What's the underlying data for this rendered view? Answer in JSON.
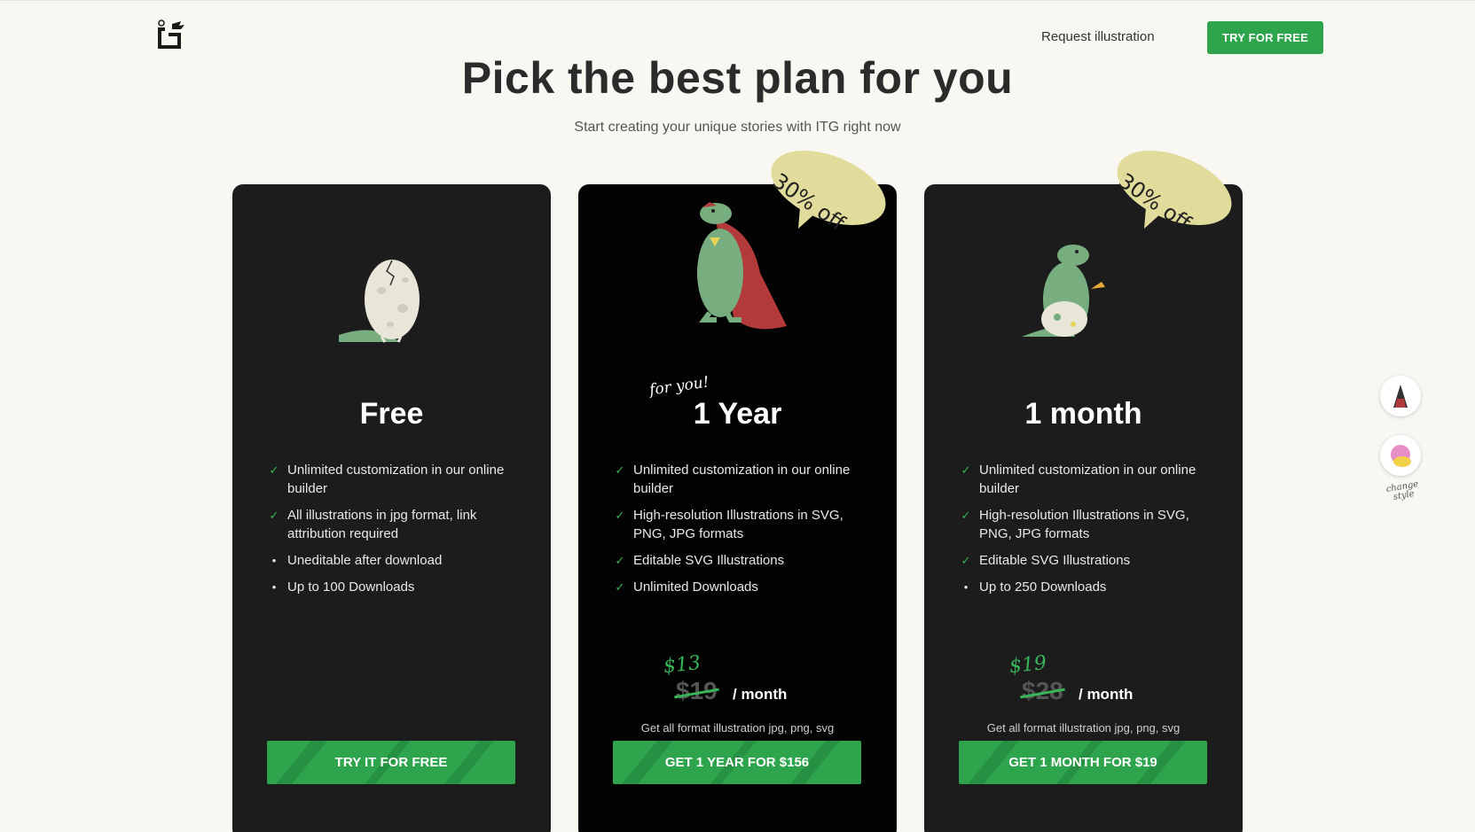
{
  "header": {
    "logo": "itg-logo",
    "nav_link": "Request illustration",
    "cta": "TRY FOR FREE"
  },
  "hero": {
    "title": "Pick the best plan for you",
    "subtitle": "Start creating your unique stories with ITG right now"
  },
  "plans": [
    {
      "name": "Free",
      "illustration": "egg-dino-icon",
      "features": [
        {
          "icon": "check",
          "text": "Unlimited customization in our online builder"
        },
        {
          "icon": "check",
          "text": "All illustrations in jpg format, link attribution required"
        },
        {
          "icon": "dot",
          "text": "Uneditable after download"
        },
        {
          "icon": "dot",
          "text": "Up to 100 Downloads"
        }
      ],
      "button": "TRY IT FOR FREE"
    },
    {
      "name": "1 Year",
      "tag": "for you!",
      "badge": "30% off",
      "illustration": "superhero-dino-icon",
      "features": [
        {
          "icon": "check",
          "text": "Unlimited customization in our online builder"
        },
        {
          "icon": "check",
          "text": "High-resolution Illustrations in SVG, PNG, JPG formats"
        },
        {
          "icon": "check",
          "text": "Editable SVG Illustrations"
        },
        {
          "icon": "check",
          "text": "Unlimited Downloads"
        }
      ],
      "new_price": "$13",
      "old_price": "$19",
      "per": "/ month",
      "note": "Get all format illustration jpg, png, svg",
      "button": "GET 1 YEAR FOR $156"
    },
    {
      "name": "1 month",
      "badge": "30% off",
      "illustration": "baby-dino-icon",
      "features": [
        {
          "icon": "check",
          "text": "Unlimited customization in our online builder"
        },
        {
          "icon": "check",
          "text": "High-resolution Illustrations in SVG, PNG, JPG formats"
        },
        {
          "icon": "check",
          "text": "Editable SVG Illustrations"
        },
        {
          "icon": "dot",
          "text": "Up to 250 Downloads"
        }
      ],
      "new_price": "$19",
      "old_price": "$28",
      "per": "/ month",
      "note": "Get all format illustration jpg, png, svg",
      "button": "GET 1 MONTH FOR $19"
    }
  ],
  "side": {
    "style_label_1": "change",
    "style_label_2": "style"
  },
  "colors": {
    "background": "#f8f7f2",
    "card": "#1c1c1c",
    "accent_green": "#2ea54d",
    "badge": "#e2dc9c",
    "dino_green": "#77ad7f"
  }
}
